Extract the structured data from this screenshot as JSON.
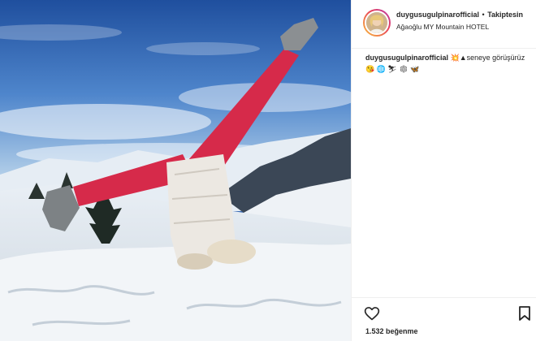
{
  "post": {
    "username": "duygusugulpinarofficial",
    "separator": "•",
    "follow_status": "Takiptesin",
    "location": "Ağaoğlu MY Mountain HOTEL"
  },
  "caption": {
    "username": "duygusugulpinarofficial",
    "text": "💥▲seneye görüşürüz 😘 🌐 ⛷ ❄ 🦋"
  },
  "likes": {
    "text": "1.532 beğenme"
  },
  "icons": {
    "like": "heart-icon",
    "save": "bookmark-icon",
    "avatar": "profile-photo"
  },
  "colors": {
    "story_ring_start": "#f9c03d",
    "story_ring_end": "#b43bb0",
    "text": "#262626",
    "pants": "#d62a4a"
  }
}
